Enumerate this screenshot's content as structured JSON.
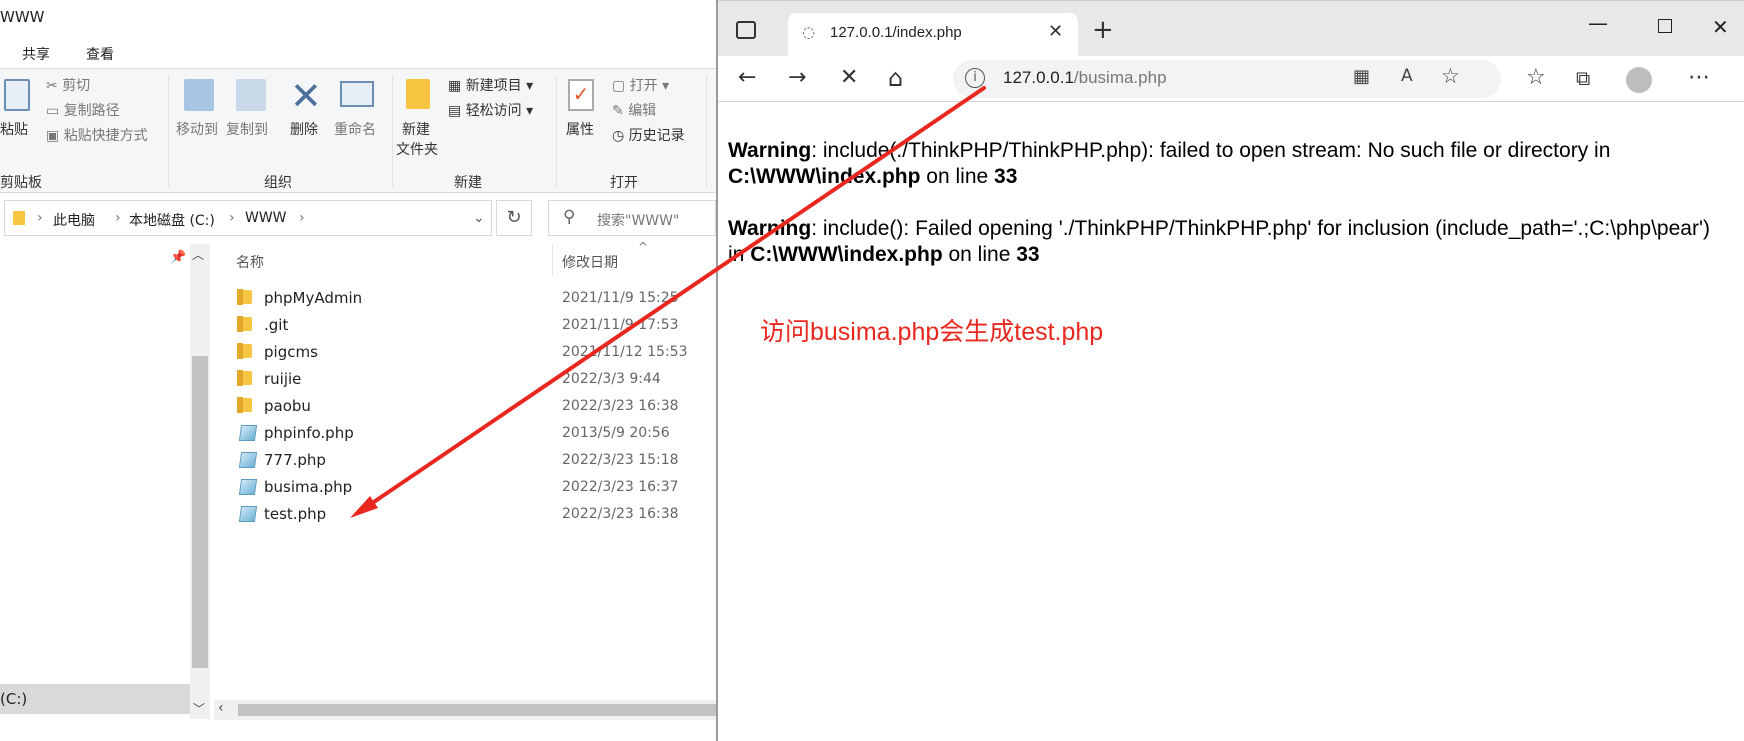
{
  "explorer": {
    "title": "WWW",
    "ribbon_tabs": [
      "共享",
      "查看"
    ],
    "clipboard": {
      "paste": "粘贴",
      "cut": "剪切",
      "copy_path": "复制路径",
      "paste_shortcut": "粘贴快捷方式",
      "group": "剪贴板"
    },
    "organize": {
      "move_to": "移动到",
      "copy_to": "复制到",
      "delete": "删除",
      "rename": "重命名",
      "group": "组织"
    },
    "new": {
      "new_item": "新建项目",
      "easy_access": "轻松访问",
      "new_folder_line1": "新建",
      "new_folder_line2": "文件夹",
      "group": "新建"
    },
    "open": {
      "properties": "属性",
      "open": "打开",
      "edit": "编辑",
      "history": "历史记录",
      "group": "打开"
    },
    "address": {
      "crumbs": [
        "此电脑",
        "本地磁盘 (C:)",
        "WWW"
      ]
    },
    "search_placeholder": "搜索\"WWW\"",
    "columns": {
      "name": "名称",
      "modified": "修改日期"
    },
    "files": [
      {
        "name": "phpMyAdmin",
        "date": "2021/11/9 15:25",
        "type": "folder"
      },
      {
        "name": ".git",
        "date": "2021/11/9 17:53",
        "type": "folder"
      },
      {
        "name": "pigcms",
        "date": "2021/11/12 15:53",
        "type": "folder"
      },
      {
        "name": "ruijie",
        "date": "2022/3/3 9:44",
        "type": "folder"
      },
      {
        "name": "paobu",
        "date": "2022/3/23 16:38",
        "type": "folder"
      },
      {
        "name": "phpinfo.php",
        "date": "2013/5/9 20:56",
        "type": "php"
      },
      {
        "name": "777.php",
        "date": "2022/3/23 15:18",
        "type": "php"
      },
      {
        "name": "busima.php",
        "date": "2022/3/23 16:37",
        "type": "php"
      },
      {
        "name": "test.php",
        "date": "2022/3/23 16:38",
        "type": "php"
      }
    ],
    "nav_drive": "(C:)"
  },
  "browser": {
    "tab_title": "127.0.0.1/index.php",
    "url_host": "127.0.0.1",
    "url_path": "/busima.php",
    "warning1": {
      "label": "Warning",
      "text": ": include(./ThinkPHP/ThinkPHP.php): failed to open stream: No such file or directory in",
      "file": "C:\\WWW\\index.php",
      "mid": " on line ",
      "line": "33"
    },
    "warning2": {
      "label": "Warning",
      "text": ": include(): Failed opening './ThinkPHP/ThinkPHP.php' for inclusion (include_path='.;C:\\php\\pear')",
      "pre": "in ",
      "file": "C:\\WWW\\index.php",
      "mid": " on line ",
      "line": "33"
    },
    "annotation": "访问busima.php会生成test.php"
  },
  "colors": {
    "annotation": "#e8281f",
    "folder": "#f6c642",
    "arrow": "#e8281f"
  }
}
